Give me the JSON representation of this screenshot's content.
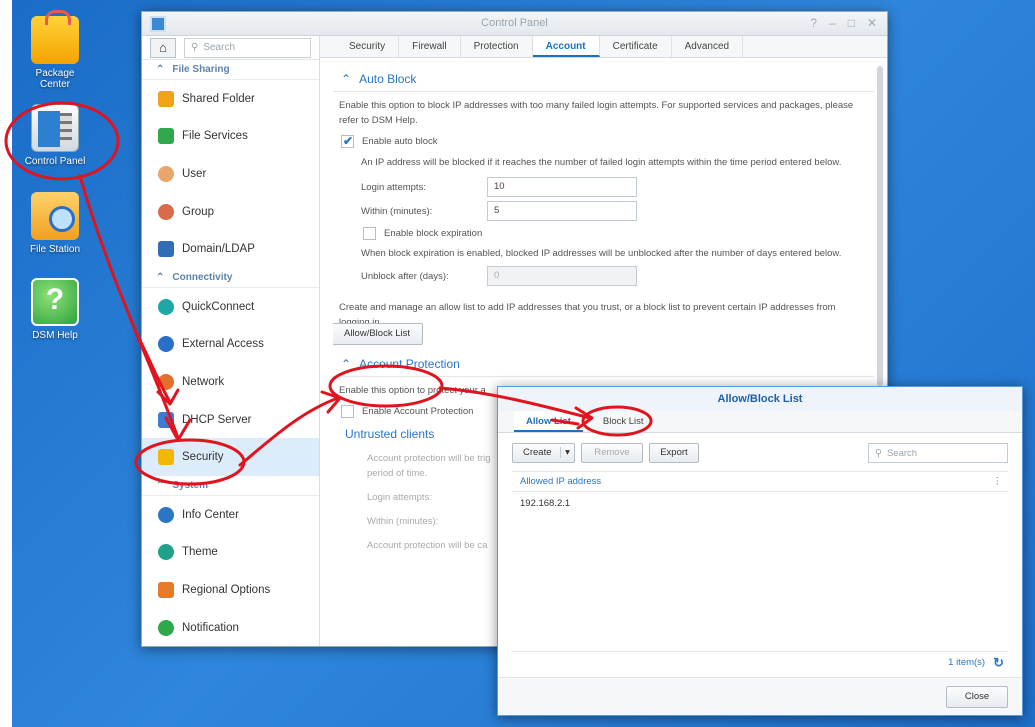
{
  "desktop": {
    "icons": [
      {
        "label": "Package\nCenter",
        "icon": "package-center-icon"
      },
      {
        "label": "Control Panel",
        "icon": "control-panel-icon"
      },
      {
        "label": "File Station",
        "icon": "file-station-icon"
      },
      {
        "label": "DSM Help",
        "icon": "dsm-help-icon",
        "glyph": "?"
      }
    ]
  },
  "control_panel": {
    "title": "Control Panel",
    "search_placeholder": "Search",
    "sections": {
      "file_sharing": "File Sharing",
      "connectivity": "Connectivity",
      "system": "System"
    },
    "items": {
      "shared_folder": "Shared Folder",
      "file_services": "File Services",
      "user": "User",
      "group": "Group",
      "domain_ldap": "Domain/LDAP",
      "quickconnect": "QuickConnect",
      "external_access": "External Access",
      "network": "Network",
      "dhcp_server": "DHCP Server",
      "security": "Security",
      "info_center": "Info Center",
      "theme": "Theme",
      "regional_options": "Regional Options",
      "notification": "Notification"
    },
    "tabs": [
      "Security",
      "Firewall",
      "Protection",
      "Account",
      "Certificate",
      "Advanced"
    ],
    "active_tab": "Account",
    "auto_block": {
      "title": "Auto Block",
      "description": "Enable this option to block IP addresses with too many failed login attempts. For supported services and packages, please refer to DSM Help.",
      "enable_label": "Enable auto block",
      "enabled": true,
      "rule_text": "An IP address will be blocked if it reaches the number of failed login attempts within the time period entered below.",
      "login_attempts_label": "Login attempts:",
      "login_attempts_value": "10",
      "within_label": "Within (minutes):",
      "within_value": "5",
      "expiration_label": "Enable block expiration",
      "expiration_text": "When block expiration is enabled, blocked IP addresses will be unblocked after the number of days entered below.",
      "unblock_label": "Unblock after (days):",
      "unblock_value": "0",
      "list_text": "Create and manage an allow list to add IP addresses that you trust, or a block list to prevent certain IP addresses from logging in.",
      "list_button": "Allow/Block List"
    },
    "account_protection": {
      "title": "Account Protection",
      "description": "Enable this option to protect your a",
      "enable_label": "Enable Account Protection",
      "untrusted_title": "Untrusted clients",
      "untrusted_text_1": "Account protection will be trig",
      "untrusted_text_2": "period of time.",
      "login_attempts_label": "Login attempts:",
      "within_label": "Within (minutes):",
      "trailing_text": "Account protection will be ca"
    }
  },
  "allow_block_dialog": {
    "title": "Allow/Block List",
    "tabs": [
      "Allow List",
      "Block List"
    ],
    "active_tab": "Allow List",
    "create_label": "Create",
    "remove_label": "Remove",
    "export_label": "Export",
    "search_placeholder": "Search",
    "column_header": "Allowed IP address",
    "rows": [
      "192.168.2.1"
    ],
    "count_text": "1 item(s)",
    "close_label": "Close"
  },
  "colors": {
    "desktop": "#1f73c9",
    "accent": "#1e6fbf",
    "annotation": "#e0141e"
  }
}
